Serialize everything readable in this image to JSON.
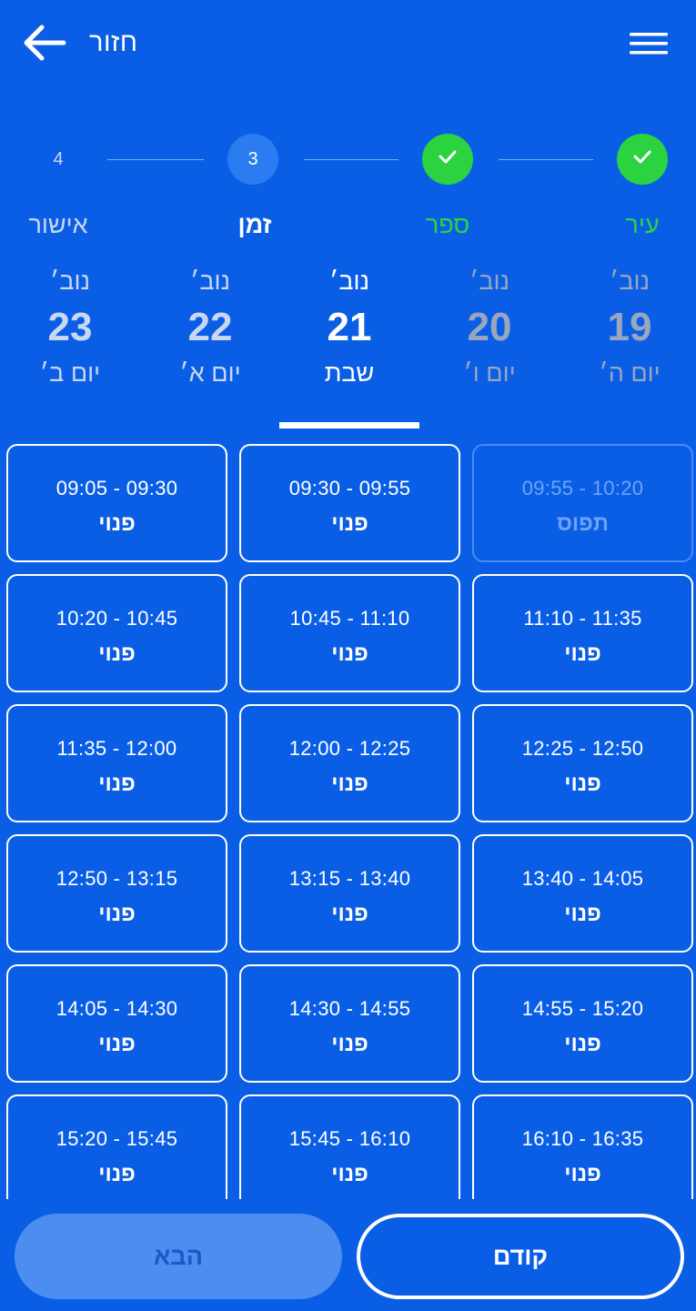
{
  "colors": {
    "background": "#0a5ee6",
    "done": "#2bd341",
    "current_step_bg": "#2a7cf0",
    "text": "#ffffff",
    "muted_text": "#c9d8f2",
    "disabled_day_text": "#9aa6bd",
    "next_button_bg": "#4c8ef0",
    "next_button_text": "#1a58c6"
  },
  "header": {
    "back_label": "חזור",
    "back_icon": "arrow-left-icon",
    "menu_icon": "hamburger-menu-icon"
  },
  "stepper": {
    "steps": [
      {
        "number": "4",
        "label": "אישור",
        "state": "future"
      },
      {
        "number": "3",
        "label": "זמן",
        "state": "current"
      },
      {
        "number": "",
        "label": "ספר",
        "state": "done"
      },
      {
        "number": "",
        "label": "עיר",
        "state": "done"
      }
    ],
    "done_icon": "check-icon"
  },
  "days": [
    {
      "month": "נוב׳",
      "number": "23",
      "name": "יום ב׳",
      "state": "available"
    },
    {
      "month": "נוב׳",
      "number": "22",
      "name": "יום א׳",
      "state": "available"
    },
    {
      "month": "נוב׳",
      "number": "21",
      "name": "שבת",
      "state": "selected"
    },
    {
      "month": "נוב׳",
      "number": "20",
      "name": "יום ו׳",
      "state": "disabled"
    },
    {
      "month": "נוב׳",
      "number": "19",
      "name": "יום ה׳",
      "state": "disabled"
    }
  ],
  "slots": [
    {
      "time": "09:05 - 09:30",
      "status": "פנוי",
      "busy": false
    },
    {
      "time": "09:30 - 09:55",
      "status": "פנוי",
      "busy": false
    },
    {
      "time": "09:55 - 10:20",
      "status": "תפוס",
      "busy": true
    },
    {
      "time": "10:20 - 10:45",
      "status": "פנוי",
      "busy": false
    },
    {
      "time": "10:45 - 11:10",
      "status": "פנוי",
      "busy": false
    },
    {
      "time": "11:10 - 11:35",
      "status": "פנוי",
      "busy": false
    },
    {
      "time": "11:35 - 12:00",
      "status": "פנוי",
      "busy": false
    },
    {
      "time": "12:00 - 12:25",
      "status": "פנוי",
      "busy": false
    },
    {
      "time": "12:25 - 12:50",
      "status": "פנוי",
      "busy": false
    },
    {
      "time": "12:50 - 13:15",
      "status": "פנוי",
      "busy": false
    },
    {
      "time": "13:15 - 13:40",
      "status": "פנוי",
      "busy": false
    },
    {
      "time": "13:40 - 14:05",
      "status": "פנוי",
      "busy": false
    },
    {
      "time": "14:05 - 14:30",
      "status": "פנוי",
      "busy": false
    },
    {
      "time": "14:30 - 14:55",
      "status": "פנוי",
      "busy": false
    },
    {
      "time": "14:55 - 15:20",
      "status": "פנוי",
      "busy": false
    },
    {
      "time": "15:20 - 15:45",
      "status": "פנוי",
      "busy": false
    },
    {
      "time": "15:45 - 16:10",
      "status": "פנוי",
      "busy": false
    },
    {
      "time": "16:10 - 16:35",
      "status": "פנוי",
      "busy": false
    }
  ],
  "buttons": {
    "next_label": "הבא",
    "prev_label": "קודם"
  }
}
